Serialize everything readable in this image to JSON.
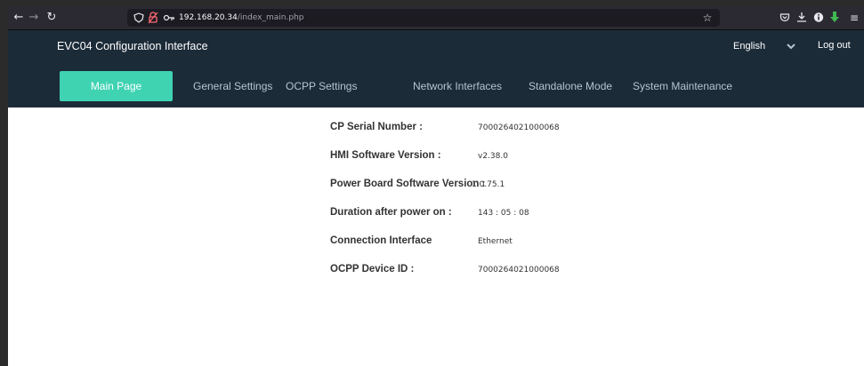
{
  "browser": {
    "url_host": "192.168.20.34",
    "url_path": "/index_main.php"
  },
  "app": {
    "title": "EVC04 Configuration Interface",
    "language": "English",
    "logout": "Log out"
  },
  "nav": {
    "items": [
      {
        "label": "Main Page",
        "active": true
      },
      {
        "label": "General Settings",
        "active": false
      },
      {
        "label": "OCPP Settings",
        "active": false
      },
      {
        "label": "Network Interfaces",
        "active": false
      },
      {
        "label": "Standalone Mode",
        "active": false
      },
      {
        "label": "System Maintenance",
        "active": false
      }
    ]
  },
  "info": {
    "rows": [
      {
        "label": "CP Serial Number :",
        "value": "7000264021000068"
      },
      {
        "label": "HMI Software Version :",
        "value": "v2.38.0"
      },
      {
        "label": "Power Board Software Version :",
        "value": "1.0.75.1"
      },
      {
        "label": "Duration after power on :",
        "value": "143 : 05 : 08"
      },
      {
        "label": "Connection Interface",
        "value": "Ethernet"
      },
      {
        "label": "OCPP Device ID :",
        "value": "7000264021000068"
      }
    ]
  },
  "colors": {
    "header_bg": "#1c2b38",
    "active_tab": "#3fd3b2",
    "browser_toolbar": "#2b2a33"
  }
}
